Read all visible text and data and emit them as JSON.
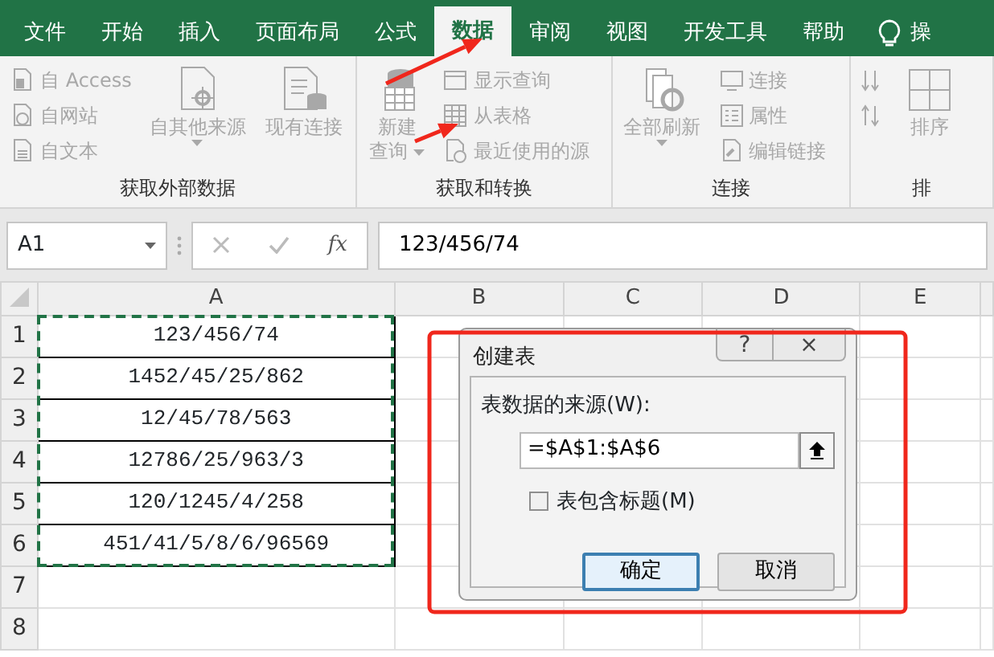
{
  "tabs": [
    {
      "label": "文件",
      "selected": false
    },
    {
      "label": "开始",
      "selected": false
    },
    {
      "label": "插入",
      "selected": false
    },
    {
      "label": "页面布局",
      "selected": false
    },
    {
      "label": "公式",
      "selected": false
    },
    {
      "label": "数据",
      "selected": true
    },
    {
      "label": "审阅",
      "selected": false
    },
    {
      "label": "视图",
      "selected": false
    },
    {
      "label": "开发工具",
      "selected": false
    },
    {
      "label": "帮助",
      "selected": false
    }
  ],
  "tell_me": {
    "label": "操"
  },
  "ribbon": {
    "groups": [
      {
        "label": "获取外部数据",
        "columns": [
          {
            "kind": "stack",
            "buttons": [
              {
                "kind": "access",
                "label": "自 Access",
                "disabled": true
              },
              {
                "kind": "web",
                "label": "自网站",
                "disabled": true
              },
              {
                "kind": "text",
                "label": "自文本",
                "disabled": true
              }
            ]
          },
          {
            "kind": "other",
            "lines": [
              "自其他来源"
            ],
            "dropdown": true,
            "disabled": true
          },
          {
            "kind": "existing",
            "lines": [
              "现有连接"
            ],
            "dropdown": false,
            "disabled": true
          }
        ]
      },
      {
        "label": "获取和转换",
        "columns": [
          {
            "kind": "newquery",
            "lines": [
              "新建",
              "查询"
            ],
            "dropdown": true,
            "disabled": true
          },
          {
            "kind": "stack",
            "buttons": [
              {
                "kind": "showquery",
                "label": "显示查询",
                "disabled": true
              },
              {
                "kind": "table",
                "label": "从表格",
                "disabled": true
              },
              {
                "kind": "recent",
                "label": "最近使用的源",
                "disabled": true
              }
            ]
          }
        ]
      },
      {
        "label": "连接",
        "columns": [
          {
            "kind": "refresh",
            "lines": [
              "全部刷新"
            ],
            "dropdown": true,
            "disabled": true
          },
          {
            "kind": "stack",
            "buttons": [
              {
                "kind": "connection",
                "label": "连接",
                "disabled": true
              },
              {
                "kind": "properties",
                "label": "属性",
                "disabled": true
              },
              {
                "kind": "links",
                "label": "编辑链接",
                "disabled": true
              }
            ]
          }
        ]
      },
      {
        "label": "排",
        "columns": [
          {
            "kind": "stack",
            "buttons": [
              {
                "kind": "sort-asc",
                "disabled": true
              },
              {
                "kind": "sort-desc",
                "disabled": true
              }
            ]
          },
          {
            "kind": "sort",
            "lines": [
              "排序"
            ],
            "dropdown": false,
            "disabled": true
          }
        ]
      }
    ]
  },
  "formula_bar": {
    "name_box": "A1",
    "function_label": "fx",
    "value": "123/456/74"
  },
  "sheet": {
    "columns": [
      "A",
      "B",
      "C",
      "D",
      "E"
    ],
    "copy_marquee": true,
    "rows": [
      {
        "header": "1",
        "cells": [
          "123/456/74"
        ]
      },
      {
        "header": "2",
        "cells": [
          "1452/45/25/862"
        ]
      },
      {
        "header": "3",
        "cells": [
          "12/45/78/563"
        ]
      },
      {
        "header": "4",
        "cells": [
          "12786/25/963/3"
        ]
      },
      {
        "header": "5",
        "cells": [
          "120/1245/4/258"
        ]
      },
      {
        "header": "6",
        "cells": [
          "451/41/5/8/6/96569"
        ]
      },
      {
        "header": "7"
      },
      {
        "header": "8"
      }
    ]
  },
  "dialog": {
    "title": "创建表",
    "help_button": "?",
    "close_button": "×",
    "source_label": "表数据的来源(W):",
    "source_value": "=$A$1:$A$6",
    "header_checkbox": {
      "label": "表包含标题(M)",
      "checked": false
    },
    "buttons": [
      {
        "label": "确定",
        "default": true
      },
      {
        "label": "取消",
        "default": false
      }
    ]
  },
  "annotations": [
    {
      "kind": "arrow"
    },
    {
      "kind": "arrow"
    },
    {
      "kind": "box"
    }
  ]
}
